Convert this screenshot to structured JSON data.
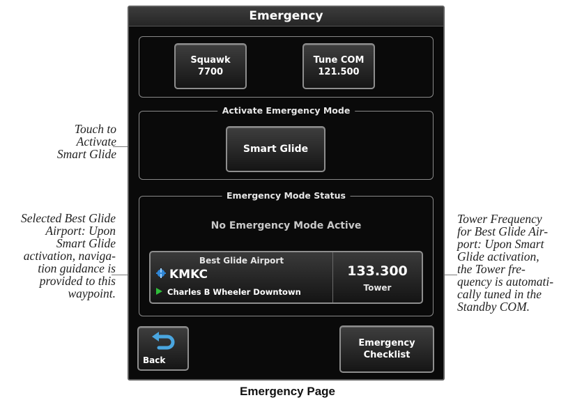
{
  "window": {
    "title": "Emergency"
  },
  "squawk_button": {
    "line1": "Squawk",
    "line2": "7700"
  },
  "tune_com_button": {
    "line1": "Tune COM",
    "line2": "121.500"
  },
  "activate_group": {
    "title": "Activate Emergency Mode",
    "button_label": "Smart Glide"
  },
  "status_group": {
    "title": "Emergency Mode Status",
    "status_text": "No Emergency Mode Active",
    "best_glide": {
      "title": "Best Glide Airport",
      "identifier": "KMKC",
      "name": "Charles B Wheeler Downtown",
      "frequency": "133.300",
      "frequency_type": "Tower"
    }
  },
  "back_button": {
    "label": "Back"
  },
  "checklist_button": {
    "line1": "Emergency",
    "line2": "Checklist"
  },
  "annotations": {
    "smart_glide": "Touch to\nActivate\nSmart Glide",
    "best_glide_airport": "Selected Best Glide\nAirport:  Upon\nSmart Glide\nactivation, naviga-\ntion guidance is\nprovided to this\nwaypoint.",
    "tower_frequency": "Tower Frequency\nfor Best Glide Air-\nport:  Upon Smart\nGlide activation,\nthe Tower fre-\nquency is automati-\ncally tuned in the\nStandby COM."
  },
  "caption": "Emergency Page",
  "colors": {
    "screen_bg": "#0a0a0a",
    "button_border": "#8e8e8e",
    "back_arrow": "#4aa6e0",
    "airport_symbol": "#2f86d6",
    "active_leg_arrow": "#2fbf3a"
  },
  "icons": {
    "back": "curved-arrow-back-icon",
    "airport": "airport-symbol-icon",
    "leg": "green-triangle-icon"
  }
}
